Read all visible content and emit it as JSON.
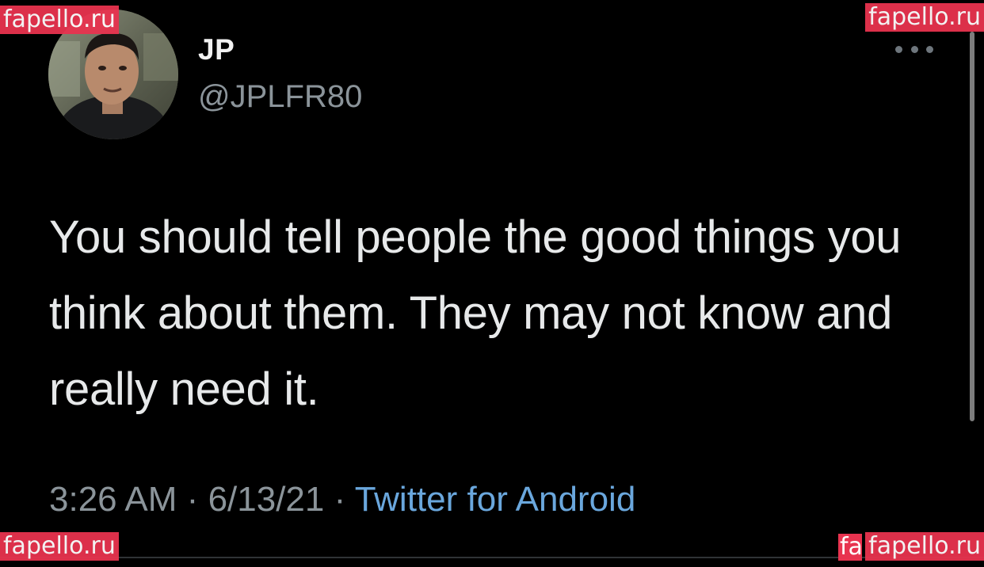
{
  "tweet": {
    "display_name": "JP",
    "handle": "@JPLFR80",
    "text": "You should tell people the good things you think about them. They may not know and really need it.",
    "time": "3:26 AM",
    "separator": "·",
    "date": "6/13/21",
    "source": "Twitter for Android"
  },
  "icons": {
    "more": "more-horizontal-icon",
    "avatar": "user-avatar"
  },
  "colors": {
    "background": "#000000",
    "text": "#e7e9ea",
    "secondary_text": "#8b949a",
    "link": "#6aa7dd",
    "watermark": "#e8334f"
  },
  "watermarks": {
    "top_left": "fapello.ru",
    "top_right": "fapello.ru",
    "bottom_left": "fapello.ru",
    "bottom_right": "fapello.ru",
    "bottom_right_partial": "fa"
  }
}
